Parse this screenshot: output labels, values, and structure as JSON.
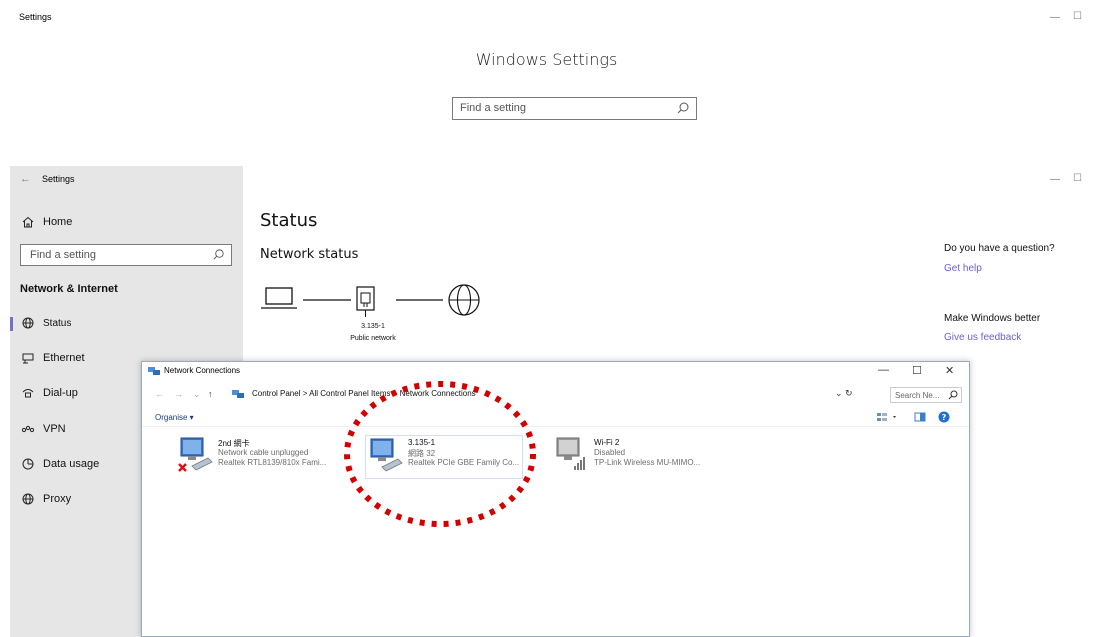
{
  "bg_window": {
    "title": "Settings",
    "heading": "Windows Settings",
    "search_placeholder": "Find a setting",
    "minimize": "—",
    "maximize": "☐"
  },
  "fg_window": {
    "title": "Settings",
    "back": "←",
    "minimize": "—",
    "maximize": "☐",
    "sidebar": {
      "home": "Home",
      "search_placeholder": "Find a setting",
      "section": "Network & Internet",
      "items": [
        {
          "label": "Status",
          "icon": "status-globe-icon"
        },
        {
          "label": "Ethernet",
          "icon": "ethernet-icon"
        },
        {
          "label": "Dial-up",
          "icon": "dial-up-icon"
        },
        {
          "label": "VPN",
          "icon": "vpn-icon"
        },
        {
          "label": "Data usage",
          "icon": "data-usage-icon"
        },
        {
          "label": "Proxy",
          "icon": "proxy-globe-icon"
        }
      ]
    },
    "main": {
      "title": "Status",
      "subtitle": "Network status",
      "network_name": "3.135-1",
      "network_type": "Public network"
    },
    "right_panel": {
      "question": "Do you have a question?",
      "help_link": "Get help",
      "better": "Make Windows better",
      "feedback_link": "Give us feedback"
    }
  },
  "nc_window": {
    "title": "Network Connections",
    "minimize": "—",
    "maximize": "☐",
    "close": "✕",
    "breadcrumb": "Control Panel  >  All Control Panel Items  >  Network Connections",
    "breadcrumb_parts": [
      "Control Panel",
      "All Control Panel Items",
      "Network Connections"
    ],
    "search_placeholder": "Search Ne...",
    "organise": "Organise ▾",
    "adapters": [
      {
        "name": "2nd 網卡",
        "status": "Network cable unplugged",
        "device": "Realtek RTL8139/810x Fami...",
        "state": "unplugged"
      },
      {
        "name": "3.135-1",
        "status": "網路 32",
        "device": "Realtek PCIe GBE Family Co...",
        "state": "connected"
      },
      {
        "name": "Wi-Fi 2",
        "status": "Disabled",
        "device": "TP-Link Wireless MU-MIMO...",
        "state": "disabled"
      }
    ]
  },
  "colors": {
    "accent": "#7670c9",
    "link": "#6b62c9",
    "sidebar_bg": "#e6e6e6",
    "highlight_ring": "#d40000"
  }
}
